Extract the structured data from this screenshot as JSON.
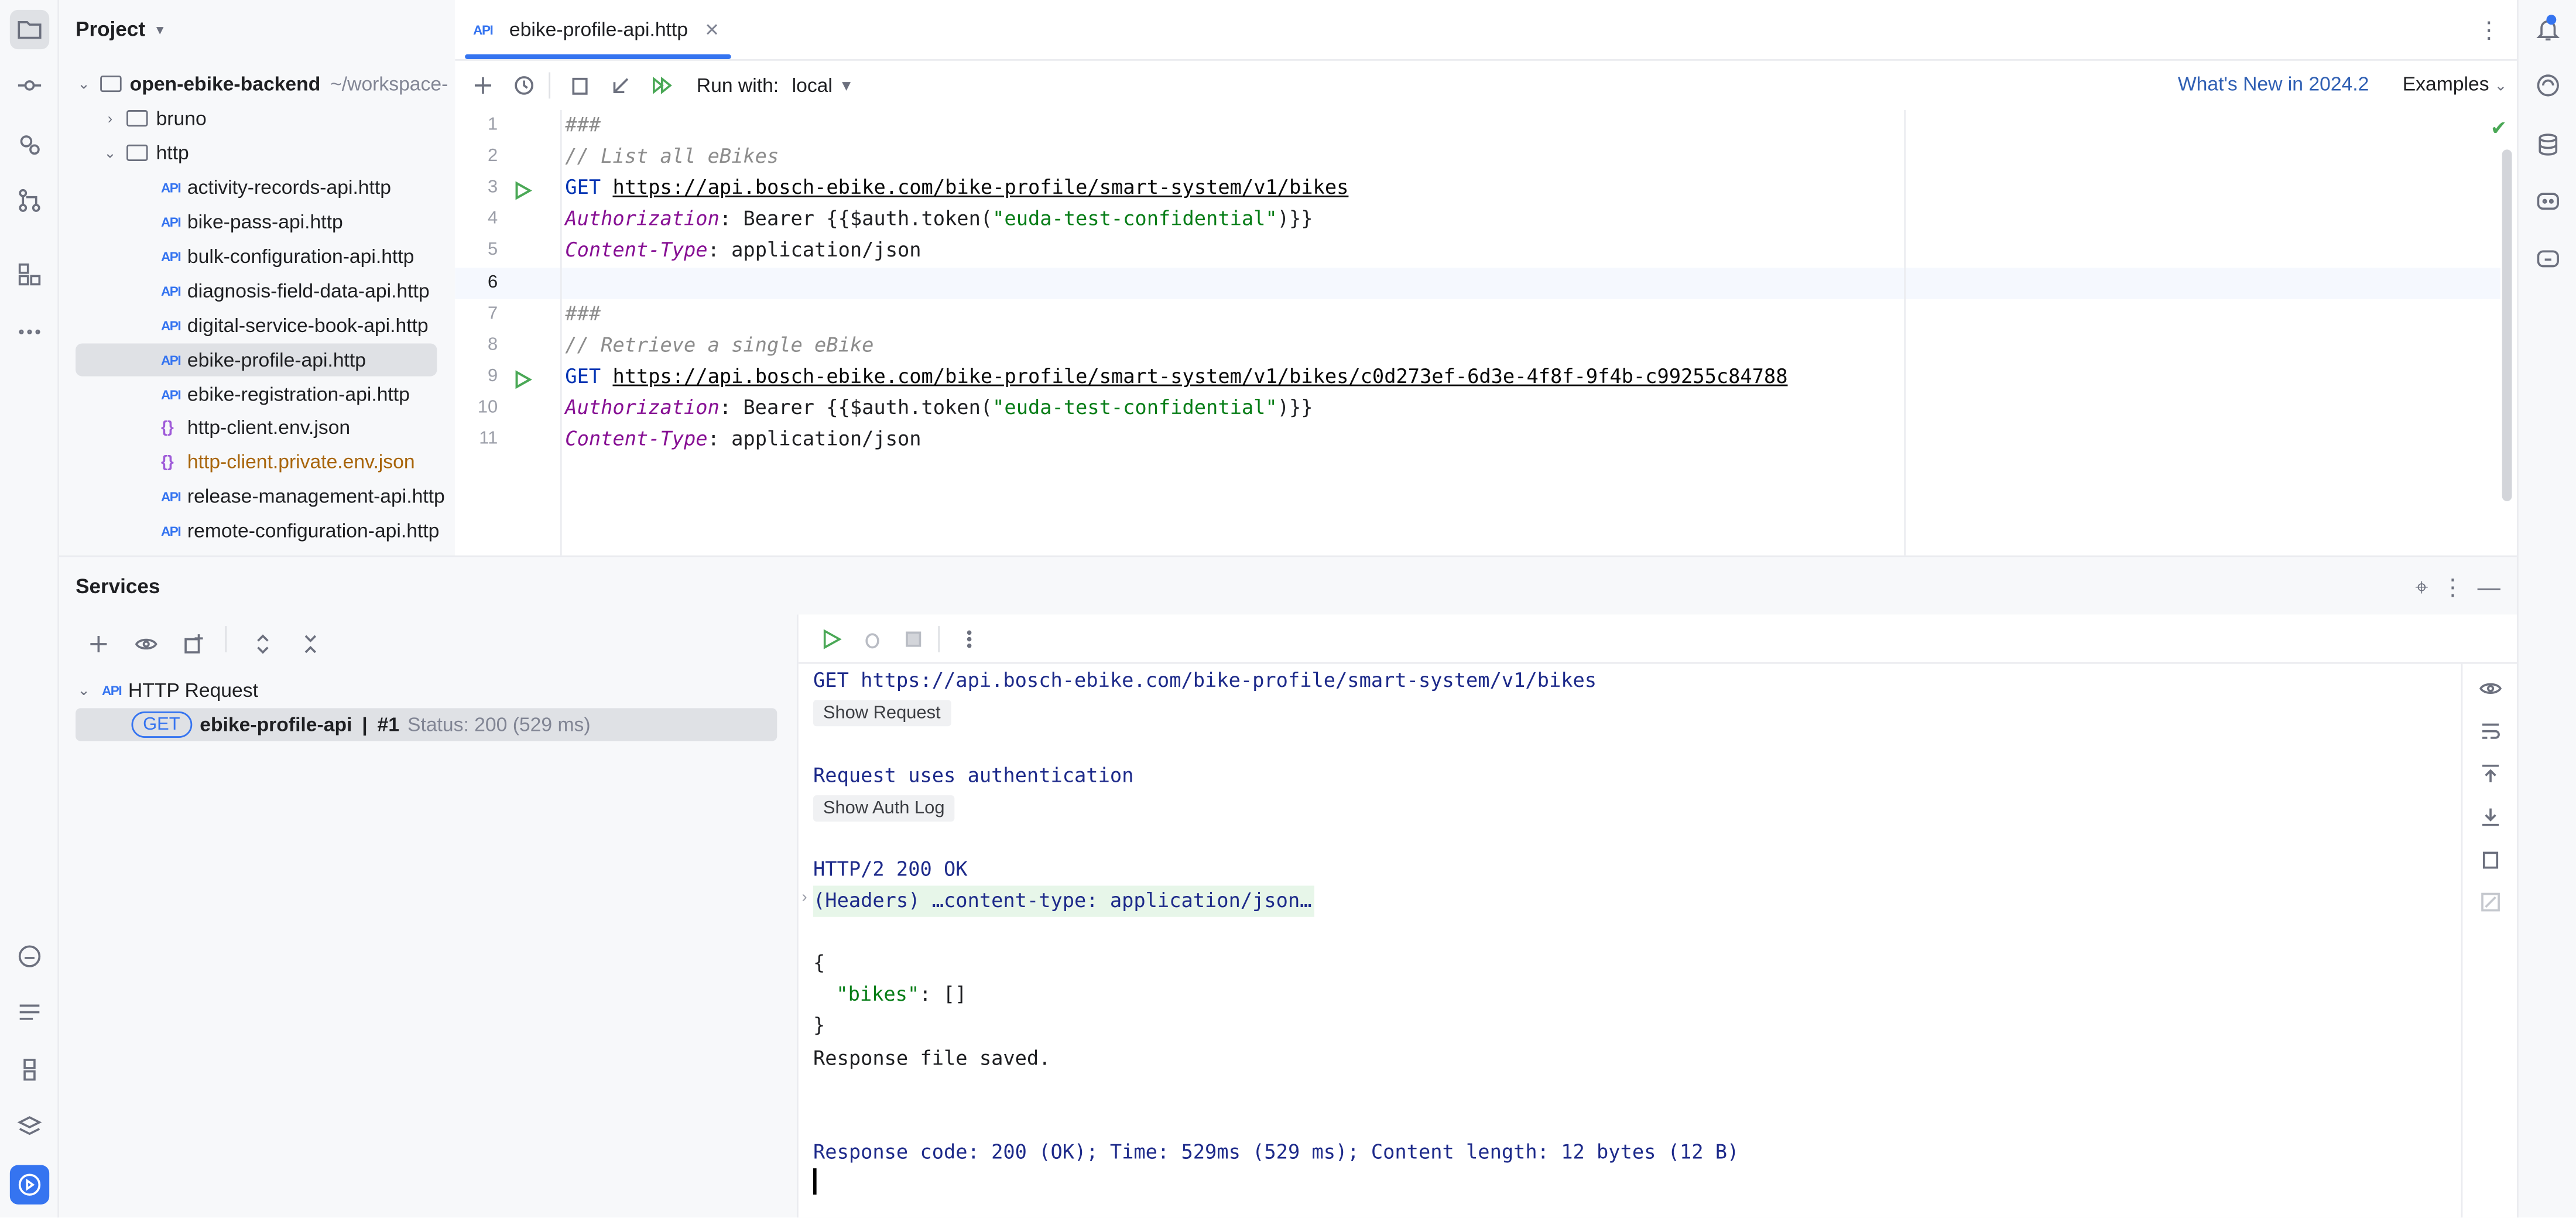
{
  "project_panel": {
    "title": "Project",
    "root_name": "open-ebike-backend",
    "root_path": "~/workspace-",
    "folders": {
      "bruno": "bruno",
      "http": "http"
    },
    "files": [
      "activity-records-api.http",
      "bike-pass-api.http",
      "bulk-configuration-api.http",
      "diagnosis-field-data-api.http",
      "digital-service-book-api.http",
      "ebike-profile-api.http",
      "ebike-registration-api.http",
      "http-client.env.json",
      "http-client.private.env.json",
      "release-management-api.http",
      "remote-configuration-api.http"
    ],
    "selected_file": "ebike-profile-api.http"
  },
  "editor": {
    "tab_label": "ebike-profile-api.http",
    "toolbar": {
      "run_with_label": "Run with:",
      "run_with_value": "local",
      "whats_new": "What's New in 2024.2",
      "examples": "Examples"
    },
    "line_numbers": [
      "1",
      "2",
      "3",
      "4",
      "5",
      "6",
      "7",
      "8",
      "9",
      "10",
      "11"
    ],
    "lines": {
      "l1": "###",
      "l2": "// List all eBikes",
      "l3_method": "GET",
      "l3_url": "https://api.bosch-ebike.com/bike-profile/smart-system/v1/bikes",
      "l4_header": "Authorization",
      "l4_pre": ": Bearer {{$auth.token(",
      "l4_str": "\"euda-test-confidential\"",
      "l4_post": ")}}",
      "l5_header": "Content-Type",
      "l5_value": ": application/json",
      "l7": "###",
      "l8": "// Retrieve a single eBike",
      "l9_method": "GET",
      "l9_url": "https://api.bosch-ebike.com/bike-profile/smart-system/v1/bikes/c0d273ef-6d3e-4f8f-9f4b-c99255c84788",
      "l10_header": "Authorization",
      "l10_pre": ": Bearer {{$auth.token(",
      "l10_str": "\"euda-test-confidential\"",
      "l10_post": ")}}",
      "l11_header": "Content-Type",
      "l11_value": ": application/json"
    }
  },
  "services": {
    "title": "Services",
    "group_label": "HTTP Request",
    "item_method": "GET",
    "item_name": "ebike-profile-api",
    "item_run": "#1",
    "item_status": "Status: 200 (529 ms)"
  },
  "console": {
    "request_line": "GET https://api.bosch-ebike.com/bike-profile/smart-system/v1/bikes",
    "show_request": "Show Request",
    "auth_line": "Request uses authentication",
    "show_auth_log": "Show Auth Log",
    "status_line": "HTTP/2 200 OK",
    "headers_line": "(Headers) …content-type: application/json…",
    "json_open": "{",
    "json_key": "\"bikes\"",
    "json_rest": ": []",
    "json_close": "}",
    "saved_line": "Response file saved.",
    "summary_line": "Response code: 200 (OK); Time: 529ms (529 ms); Content length: 12 bytes (12 B)"
  },
  "colors": {
    "accent": "#3574f0",
    "run_green": "#4aa856",
    "selection": "#dfe1e5"
  }
}
